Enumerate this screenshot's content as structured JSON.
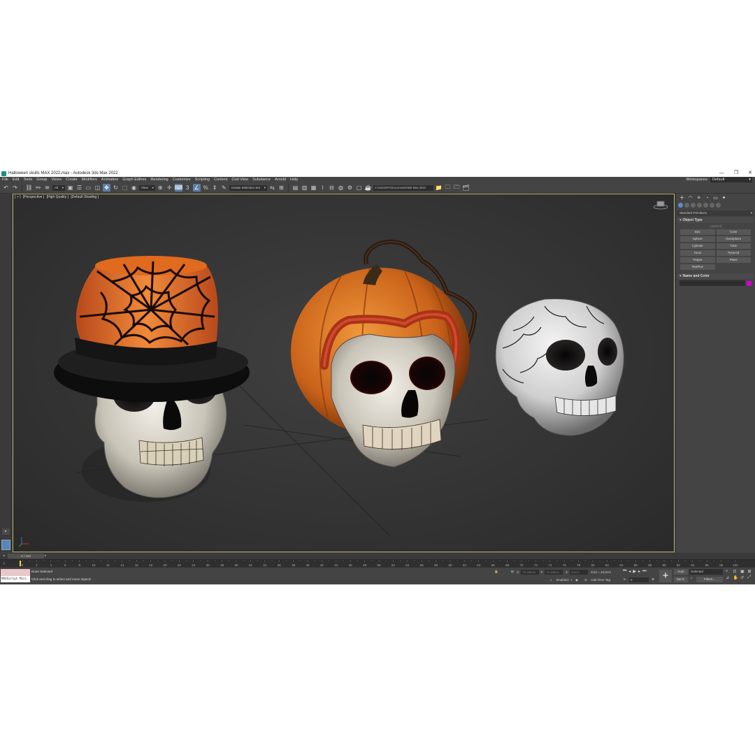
{
  "window": {
    "title": "Halloween skulls MAX 2022.max - Autodesk 3ds Max 2022",
    "controls": [
      "—",
      "❐",
      "✕"
    ]
  },
  "menu": {
    "items": [
      "File",
      "Edit",
      "Tools",
      "Group",
      "Views",
      "Create",
      "Modifiers",
      "Animation",
      "Graph Editors",
      "Rendering",
      "Customize",
      "Scripting",
      "Content",
      "Civil View",
      "Substance",
      "Arnold",
      "Help"
    ],
    "workspace_label": "Workspaces:",
    "workspace_value": "Default"
  },
  "toolbar": {
    "selection_filter": "All",
    "reference_coord": "View",
    "named_selection": "Create Selection Set",
    "project_path": "C:\\Users\\PC\\Documents\\3ds Max 2022"
  },
  "viewport": {
    "label_plus": "[ + ]",
    "label_view": "[Perspective ]",
    "label_quality": "[High Quality ]",
    "label_shading": "[Default Shading ]"
  },
  "command_panel": {
    "category": "Standard Primitives",
    "object_type_title": "Object Type",
    "autogrid": "AutoGrid",
    "primitives": [
      "Box",
      "Cone",
      "Sphere",
      "GeoSphere",
      "Cylinder",
      "Tube",
      "Torus",
      "Pyramid",
      "Teapot",
      "Plane",
      "TextPlus"
    ],
    "name_color_title": "Name and Color"
  },
  "timeline": {
    "frame_display": "0 / 100",
    "ticks": [
      "0",
      "2",
      "4",
      "6",
      "8",
      "10",
      "12",
      "14",
      "16",
      "18",
      "20",
      "22",
      "24",
      "26",
      "28",
      "30",
      "32",
      "34",
      "36",
      "38",
      "40",
      "42",
      "44",
      "46",
      "48",
      "50",
      "52",
      "54",
      "56",
      "58",
      "60",
      "62",
      "64",
      "66",
      "68",
      "70",
      "72",
      "74",
      "76",
      "78",
      "80",
      "82",
      "84",
      "86",
      "88",
      "90",
      "92",
      "94",
      "96",
      "98",
      "100"
    ]
  },
  "status": {
    "maxscript": "MAXScript Mini",
    "selection": "None Selected",
    "prompt": "Click and drag to select and move objects",
    "x_label": "X:",
    "y_label": "Y:",
    "z_label": "Z:",
    "x_value": "78,496cm",
    "y_value": "72,466cm",
    "z_value": "0,0cm",
    "grid": "Grid = 10,0cm",
    "enabled": "Enabled:",
    "add_time_tag": "Add Time Tag",
    "frame_value": "0",
    "auto": "Auto",
    "selected": "Selected",
    "set_key": "Set K.",
    "filters": "Filters..."
  },
  "colors": {
    "accent": "#5d7fa8",
    "viewport_border": "#b8b068",
    "swatch": "#d400d4"
  }
}
